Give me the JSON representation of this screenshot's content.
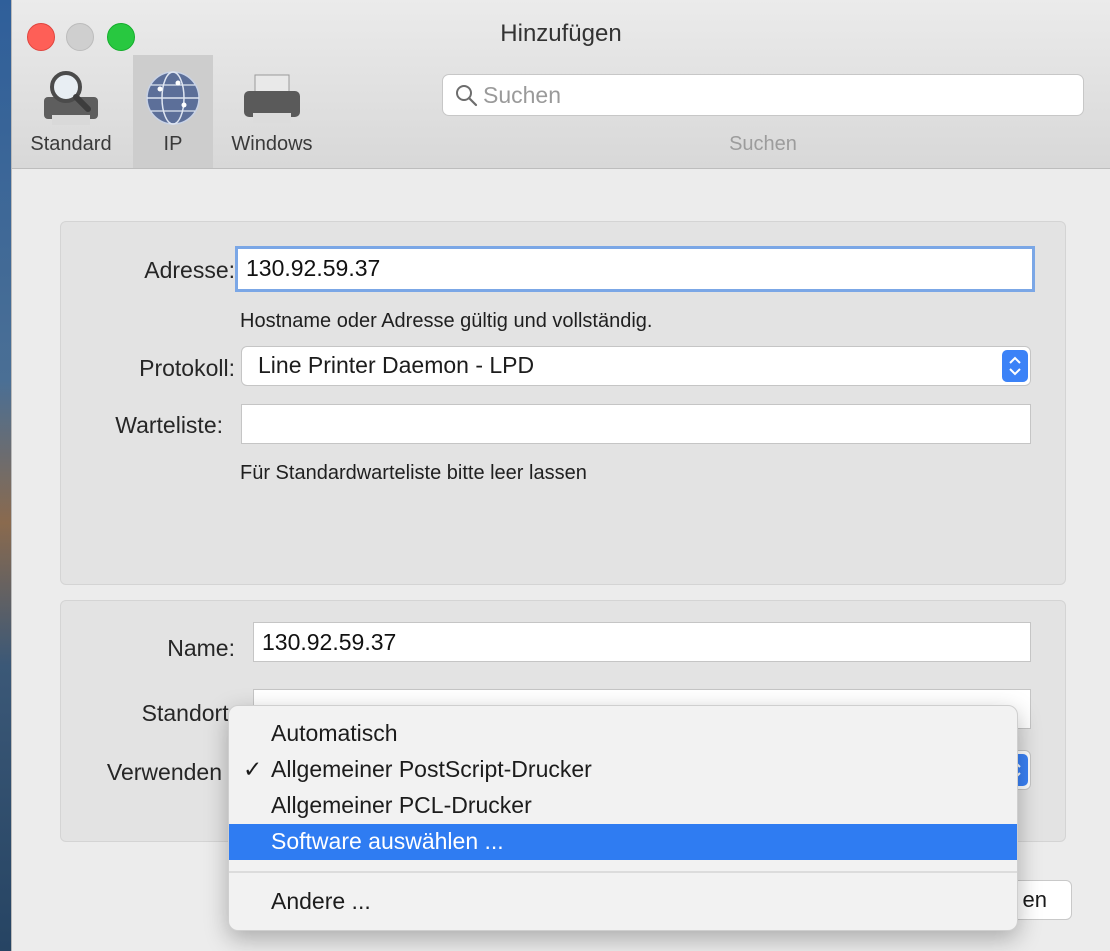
{
  "window": {
    "title": "Hinzufügen"
  },
  "toolbar": {
    "tabs": [
      {
        "label": "Standard",
        "icon": "printer-magnifier-icon"
      },
      {
        "label": "IP",
        "icon": "globe-network-icon",
        "selected": true
      },
      {
        "label": "Windows",
        "icon": "printer-icon"
      }
    ],
    "search": {
      "placeholder": "Suchen",
      "caption": "Suchen",
      "icon": "search-icon"
    }
  },
  "connection": {
    "address_label": "Adresse:",
    "address_value": "130.92.59.37",
    "address_hint": "Hostname oder Adresse gültig und vollständig.",
    "protocol_label": "Protokoll:",
    "protocol_value": "Line Printer Daemon - LPD",
    "queue_label": "Warteliste:",
    "queue_value": "",
    "queue_hint": "Für Standardwarteliste bitte leer lassen"
  },
  "details": {
    "name_label": "Name:",
    "name_value": "130.92.59.37",
    "location_label": "Standort:",
    "location_value": "",
    "use_label": "Verwenden"
  },
  "use_menu": {
    "items": [
      {
        "label": "Automatisch",
        "checked": false
      },
      {
        "label": "Allgemeiner PostScript-Drucker",
        "checked": true,
        "check": "✓"
      },
      {
        "label": "Allgemeiner PCL-Drucker",
        "checked": false
      },
      {
        "label": "Software auswählen ...",
        "highlighted": true
      },
      {
        "label": "Andere ..."
      }
    ]
  },
  "footer": {
    "add_button_visible_text": "en"
  },
  "colors": {
    "accent": "#2f7cf2",
    "close": "#fe5f57",
    "maximize": "#28c840"
  }
}
